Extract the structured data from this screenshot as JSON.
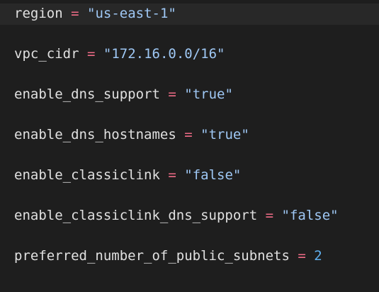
{
  "code_lines": [
    {
      "key": "region",
      "op": "=",
      "value": "\"us-east-1\"",
      "value_type": "string"
    },
    {
      "key": "vpc_cidr",
      "op": "=",
      "value": "\"172.16.0.0/16\"",
      "value_type": "string"
    },
    {
      "key": "enable_dns_support",
      "op": "=",
      "value": "\"true\"",
      "value_type": "string"
    },
    {
      "key": "enable_dns_hostnames",
      "op": "=",
      "value": "\"true\"",
      "value_type": "string"
    },
    {
      "key": "enable_classiclink",
      "op": "=",
      "value": "\"false\"",
      "value_type": "string"
    },
    {
      "key": "enable_classiclink_dns_support",
      "op": "=",
      "value": "\"false\"",
      "value_type": "string"
    },
    {
      "key": "preferred_number_of_public_subnets",
      "op": "=",
      "value": "2",
      "value_type": "number"
    }
  ],
  "colors": {
    "background": "#1e1e1e",
    "current_line": "#282828",
    "identifier": "#e0e0e0",
    "operator": "#f06c87",
    "string": "#9fc8f5",
    "number": "#5fb0f0"
  }
}
